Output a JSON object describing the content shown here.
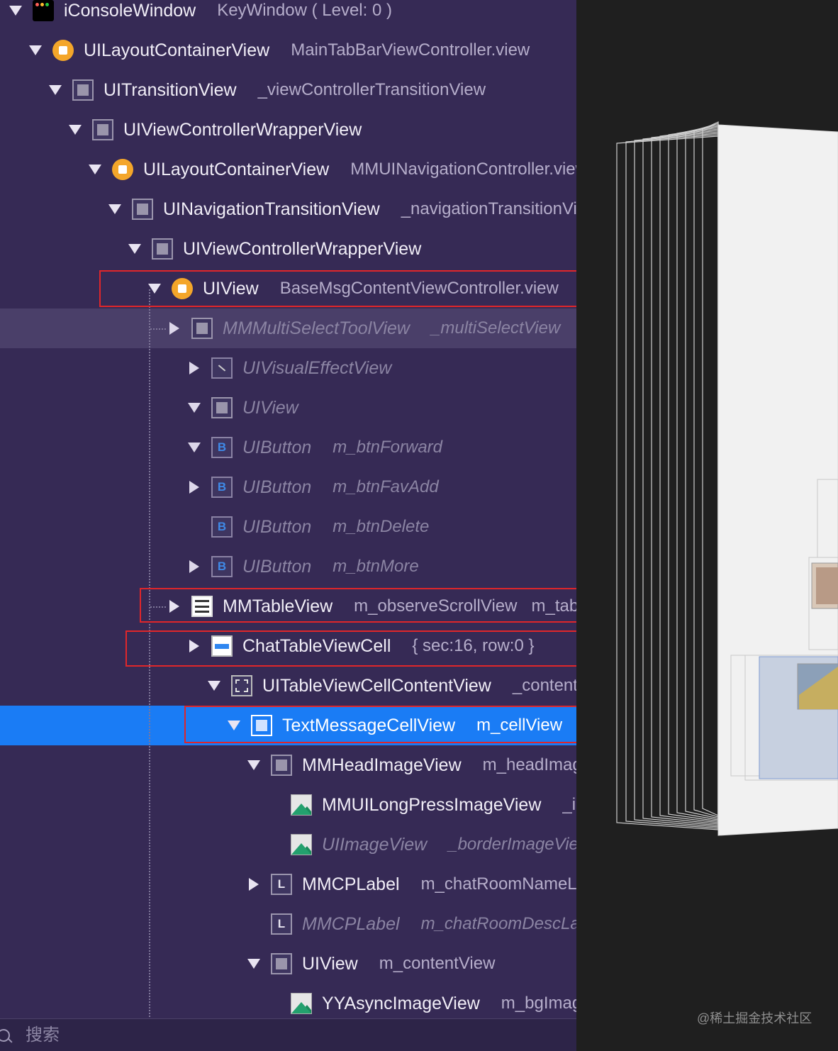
{
  "tree": [
    {
      "cls": "iConsoleWindow",
      "name": "KeyWindow ( Level: 0 )",
      "icon": "app",
      "disc": "down",
      "indent": 0
    },
    {
      "cls": "UILayoutContainerView",
      "name": "MainTabBarViewController.view",
      "icon": "circle",
      "disc": "down",
      "indent": 1
    },
    {
      "cls": "UITransitionView",
      "name": "_viewControllerTransitionView",
      "icon": "box",
      "disc": "down",
      "indent": 2
    },
    {
      "cls": "UIViewControllerWrapperView",
      "name": "",
      "icon": "box",
      "disc": "down",
      "indent": 3
    },
    {
      "cls": "UILayoutContainerView",
      "name": "MMUINavigationController.view",
      "icon": "circle",
      "disc": "down",
      "indent": 4
    },
    {
      "cls": "UINavigationTransitionView",
      "name": "_navigationTransitionView",
      "icon": "box",
      "disc": "down",
      "indent": 5
    },
    {
      "cls": "UIViewControllerWrapperView",
      "name": "",
      "icon": "box",
      "disc": "down",
      "indent": 6
    },
    {
      "cls": "UIView",
      "name": "BaseMsgContentViewController.view",
      "icon": "circle",
      "disc": "down",
      "indent": 7
    },
    {
      "cls": "MMMultiSelectToolView",
      "name": "_multiSelectView",
      "icon": "box",
      "disc": "right",
      "indent": 8,
      "dim": true,
      "hover": true
    },
    {
      "cls": "UIVisualEffectView",
      "name": "",
      "icon": "effect",
      "disc": "right",
      "indent": 9,
      "dim": true
    },
    {
      "cls": "UIView",
      "name": "",
      "icon": "box",
      "disc": "down",
      "indent": 9,
      "dim": true
    },
    {
      "cls": "UIButton",
      "name": "m_btnForward",
      "icon": "btn",
      "glyph": "B",
      "disc": "down",
      "indent": 9,
      "dim": true
    },
    {
      "cls": "UIButton",
      "name": "m_btnFavAdd",
      "icon": "btn",
      "glyph": "B",
      "disc": "right",
      "indent": 9,
      "dim": true
    },
    {
      "cls": "UIButton",
      "name": "m_btnDelete",
      "icon": "btn",
      "glyph": "B",
      "disc": "none",
      "indent": 9,
      "dim": true
    },
    {
      "cls": "UIButton",
      "name": "m_btnMore",
      "icon": "btn",
      "glyph": "B",
      "disc": "right",
      "indent": 9,
      "dim": true
    },
    {
      "cls": "MMTableView",
      "name": "m_observeScrollView",
      "extra": "m_tableView",
      "icon": "table",
      "disc": "right",
      "indent": 8
    },
    {
      "cls": "ChatTableViewCell",
      "name": "{ sec:16, row:0 }",
      "icon": "cell",
      "disc": "right",
      "indent": 9
    },
    {
      "cls": "UITableViewCellContentView",
      "name": "_contentView",
      "icon": "content",
      "disc": "down",
      "indent": 10
    },
    {
      "cls": "TextMessageCellView",
      "name": "m_cellView",
      "icon": "selbox",
      "disc": "down",
      "indent": 11,
      "selected": true
    },
    {
      "cls": "MMHeadImageView",
      "name": "m_headImageView",
      "icon": "box",
      "disc": "down",
      "indent": 12
    },
    {
      "cls": "MMUILongPressImageView",
      "name": "_imageView",
      "icon": "img",
      "disc": "none",
      "indent": 13
    },
    {
      "cls": "UIImageView",
      "name": "_borderImageView",
      "icon": "img",
      "disc": "none",
      "indent": 13,
      "dim": true
    },
    {
      "cls": "MMCPLabel",
      "name": "m_chatRoomNameLabel",
      "icon": "label",
      "glyph": "L",
      "disc": "right",
      "indent": 12
    },
    {
      "cls": "MMCPLabel",
      "name": "m_chatRoomDescLabel",
      "icon": "label",
      "glyph": "L",
      "disc": "none",
      "indent": 12,
      "dim": true
    },
    {
      "cls": "UIView",
      "name": "m_contentView",
      "icon": "box",
      "disc": "down",
      "indent": 12
    },
    {
      "cls": "YYAsyncImageView",
      "name": "m_bgImageView",
      "icon": "img",
      "disc": "none",
      "indent": 13
    }
  ],
  "search": {
    "placeholder": "搜索"
  },
  "watermark": "@稀土掘金技术社区",
  "colors": {
    "navigator": "#362a55",
    "selected": "#1a7cf5",
    "highlight": "#e0262a"
  }
}
